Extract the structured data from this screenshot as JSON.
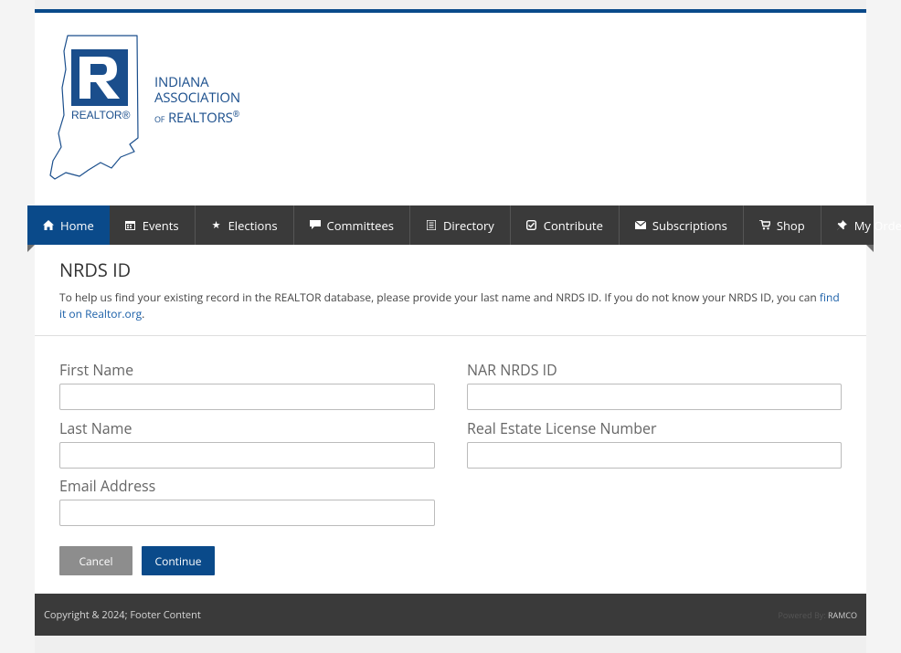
{
  "brand": {
    "line1": "INDIANA",
    "line2": "ASSOCIATION",
    "line3_small": "OF",
    "line3": "REALTORS",
    "reg": "®",
    "mark_label": "REALTOR®",
    "accent": "#0a4a8a"
  },
  "nav": {
    "items": [
      {
        "label": "Home",
        "icon": "home-icon",
        "active": true
      },
      {
        "label": "Events",
        "icon": "calendar-icon"
      },
      {
        "label": "Elections",
        "icon": "star-icon"
      },
      {
        "label": "Committees",
        "icon": "comment-icon"
      },
      {
        "label": "Directory",
        "icon": "book-icon"
      },
      {
        "label": "Contribute",
        "icon": "check-icon"
      },
      {
        "label": "Subscriptions",
        "icon": "envelope-icon"
      },
      {
        "label": "Shop",
        "icon": "cart-icon"
      },
      {
        "label": "My Orders",
        "icon": "pin-icon"
      }
    ]
  },
  "page": {
    "title": "NRDS ID",
    "intro": "To help us find your existing record in the REALTOR database, please provide your last name and NRDS ID. If you do not know your NRDS ID, you can ",
    "intro_link": "find it on Realtor.org",
    "intro_end": "."
  },
  "form": {
    "first_name_label": "First Name",
    "first_name_value": "",
    "last_name_label": "Last Name",
    "last_name_value": "",
    "email_label": "Email Address",
    "email_value": "",
    "nrds_label": "NAR NRDS ID",
    "nrds_value": "",
    "license_label": "Real Estate License Number",
    "license_value": "",
    "cancel_label": "Cancel",
    "continue_label": "Continue"
  },
  "footer": {
    "copyright": "Copyright & 2024; Footer Content",
    "powered_prefix": "Powered By:",
    "powered_brand": "RAMCO"
  }
}
